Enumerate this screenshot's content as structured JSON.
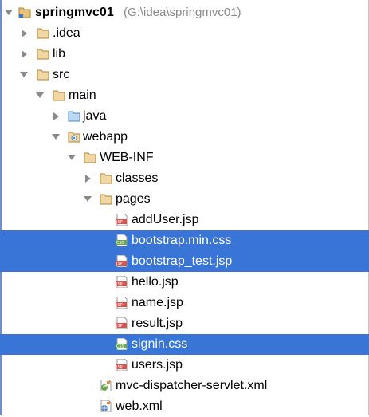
{
  "project": {
    "name": "springmvc01",
    "path": "(G:\\idea\\springmvc01)"
  },
  "items": [
    {
      "label": ".idea",
      "icon": "folder-icon"
    },
    {
      "label": "lib",
      "icon": "folder-icon"
    },
    {
      "label": "src",
      "icon": "folder-icon"
    },
    {
      "label": "main",
      "icon": "folder-icon"
    },
    {
      "label": "java",
      "icon": "source-folder-icon"
    },
    {
      "label": "webapp",
      "icon": "web-folder-icon"
    },
    {
      "label": "WEB-INF",
      "icon": "folder-icon"
    },
    {
      "label": "classes",
      "icon": "folder-icon"
    },
    {
      "label": "pages",
      "icon": "folder-icon"
    },
    {
      "label": "addUser.jsp",
      "icon": "jsp-file-icon"
    },
    {
      "label": "bootstrap.min.css",
      "icon": "css-file-icon"
    },
    {
      "label": "bootstrap_test.jsp",
      "icon": "jsp-file-icon"
    },
    {
      "label": "hello.jsp",
      "icon": "jsp-file-icon"
    },
    {
      "label": "name.jsp",
      "icon": "jsp-file-icon"
    },
    {
      "label": "result.jsp",
      "icon": "jsp-file-icon"
    },
    {
      "label": "signin.css",
      "icon": "css-file-icon"
    },
    {
      "label": "users.jsp",
      "icon": "jsp-file-icon"
    },
    {
      "label": "mvc-dispatcher-servlet.xml",
      "icon": "spring-xml-file-icon"
    },
    {
      "label": "web.xml",
      "icon": "web-xml-file-icon"
    }
  ],
  "colors": {
    "selection": "#3875d7",
    "folder": "#c89a4b",
    "source_folder": "#5b9bd5",
    "jsp": "#d9534f",
    "css": "#6aa84f",
    "spring": "#6aa84f"
  }
}
